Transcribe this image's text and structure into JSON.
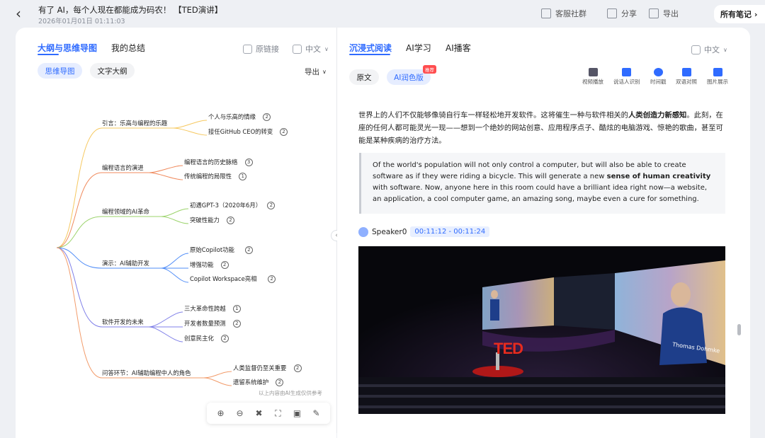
{
  "header": {
    "title": "有了 AI，每个人现在都能成为码农！ 【TED演讲】",
    "date": "2026年01月01日 01:11:03",
    "customer_service": "客服社群",
    "share": "分享",
    "export": "导出",
    "all_notes": "所有笔记"
  },
  "left": {
    "tabs": [
      "大纲与思维导图",
      "我的总结"
    ],
    "source_link": "原链接",
    "lang": "中文",
    "modes": [
      "思维导图",
      "文字大纲"
    ],
    "export": "导出",
    "disclaimer": "以上内容由AI生成仅供参考",
    "mindmap": [
      {
        "label": "引言：乐高与编程的乐趣",
        "children": [
          {
            "label": "个人与乐高的情缘",
            "count": "2"
          },
          {
            "label": "接任GitHub CEO的转变",
            "count": "2"
          }
        ]
      },
      {
        "label": "编程语言的演进",
        "children": [
          {
            "label": "编程语言的历史脉络",
            "count": "3"
          },
          {
            "label": "传统编程的局限性",
            "count": "1"
          }
        ]
      },
      {
        "label": "编程领域的AI革命",
        "children": [
          {
            "label": "初遇GPT-3（2020年6月）",
            "count": "2"
          },
          {
            "label": "突破性能力",
            "count": "2"
          }
        ]
      },
      {
        "label": "演示：AI辅助开发",
        "children": [
          {
            "label": "原始Copilot功能",
            "count": "2"
          },
          {
            "label": "增强功能",
            "count": "2"
          },
          {
            "label": "Copilot Workspace亮相",
            "count": "2"
          }
        ]
      },
      {
        "label": "软件开发的未来",
        "children": [
          {
            "label": "三大革命性跨越",
            "count": "1"
          },
          {
            "label": "开发者数量预测",
            "count": "2"
          },
          {
            "label": "创意民主化",
            "count": "2"
          }
        ]
      },
      {
        "label": "问答环节：AI辅助编程中人的角色",
        "children": [
          {
            "label": "人类监督仍至关重要",
            "count": "2"
          },
          {
            "label": "遗留系统维护",
            "count": "2"
          }
        ]
      }
    ],
    "branch_colors": [
      "#f6c85f",
      "#f08a5d",
      "#9bd36b",
      "#4f8cf7",
      "#7f7fe8",
      "#f29b6a"
    ]
  },
  "right": {
    "tabs": [
      "沉浸式阅读",
      "AI学习",
      "AI播客"
    ],
    "lang": "中文",
    "versions": [
      "原文",
      "AI润色版"
    ],
    "badge": "推荐",
    "tools": [
      "视频播放",
      "说话人识别",
      "时间戳",
      "双语对照",
      "图片展示"
    ],
    "zh_paragraph_a": "世界上的人们不仅能够像骑自行车一样轻松地开发软件。这将催生一种与软件相关的",
    "zh_paragraph_bold": "人类创造力新感知",
    "zh_paragraph_b": "。此刻，在座的任何人都可能灵光一现——想到一个绝妙的网站创意、应用程序点子、酷炫的电脑游戏、惊艳的歌曲，甚至可能是某种疾病的治疗方法。",
    "en_a": "Of the world's population will not only control a computer, but will also be able to create software as if they were riding a bicycle. This will generate a new ",
    "en_bold": "sense of human creativity",
    "en_b": " with software. Now, anyone here in this room could have a brilliant idea right now—a website, an application, a cool computer game, an amazing song, maybe even a cure for something.",
    "speaker": "Speaker0",
    "time_range": "00:11:12 - 00:11:24",
    "video_logo": "TED",
    "video_caption": "Thomas Dohmke"
  }
}
